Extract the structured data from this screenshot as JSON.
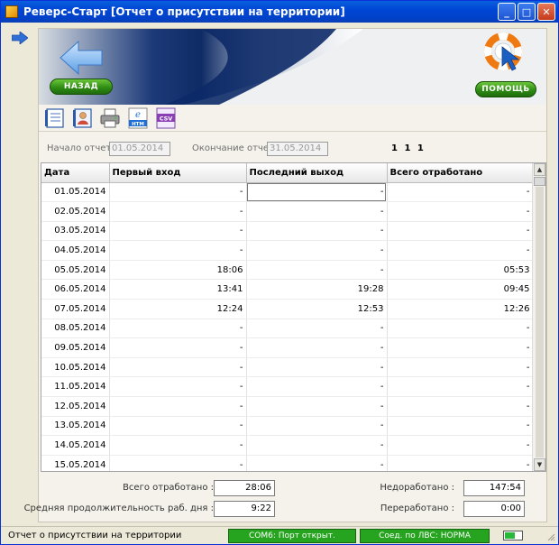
{
  "window": {
    "title": "Реверс-Старт  [Отчет о присутствии на территории]",
    "minimize_glyph": "_",
    "maximize_glyph": "□",
    "close_glyph": "✕"
  },
  "banner": {
    "back_label": "НАЗАД",
    "help_label": "ПОМОЩЬ"
  },
  "toolbar": {
    "icons": [
      "report-list-icon",
      "employee-card-icon",
      "printer-icon",
      "export-htm-icon",
      "export-csv-icon"
    ],
    "htm_label": "HTM",
    "csv_label": "CSV"
  },
  "filter": {
    "start_label": "Начало отчета:",
    "start_value": "01.05.2014",
    "end_label": "Окончание отчета:",
    "end_value": "31.05.2014",
    "counter": "1 1 1"
  },
  "table": {
    "headers": [
      "Дата",
      "Первый вход",
      "Последний выход",
      "Всего отработано"
    ],
    "rows": [
      [
        "01.05.2014",
        "-",
        "-",
        "-"
      ],
      [
        "02.05.2014",
        "-",
        "-",
        "-"
      ],
      [
        "03.05.2014",
        "-",
        "-",
        "-"
      ],
      [
        "04.05.2014",
        "-",
        "-",
        "-"
      ],
      [
        "05.05.2014",
        "18:06",
        "-",
        "05:53"
      ],
      [
        "06.05.2014",
        "13:41",
        "19:28",
        "09:45"
      ],
      [
        "07.05.2014",
        "12:24",
        "12:53",
        "12:26"
      ],
      [
        "08.05.2014",
        "-",
        "-",
        "-"
      ],
      [
        "09.05.2014",
        "-",
        "-",
        "-"
      ],
      [
        "10.05.2014",
        "-",
        "-",
        "-"
      ],
      [
        "11.05.2014",
        "-",
        "-",
        "-"
      ],
      [
        "12.05.2014",
        "-",
        "-",
        "-"
      ],
      [
        "13.05.2014",
        "-",
        "-",
        "-"
      ],
      [
        "14.05.2014",
        "-",
        "-",
        "-"
      ],
      [
        "15.05.2014",
        "-",
        "-",
        "-"
      ]
    ]
  },
  "summary": {
    "total_label": "Всего отработано :",
    "total_value": "28:06",
    "avg_label": "Средняя продолжительность раб. дня :",
    "avg_value": "9:22",
    "under_label": "Недоработано :",
    "under_value": "147:54",
    "over_label": "Переработано :",
    "over_value": "0:00"
  },
  "statusbar": {
    "text": "Отчет о присутствии на территории",
    "com_status": "COM6: Порт открыт.",
    "lan_status": "Соед. по ЛВС: НОРМА",
    "battery_level": 0.6,
    "accent_green": "#26a31f"
  }
}
